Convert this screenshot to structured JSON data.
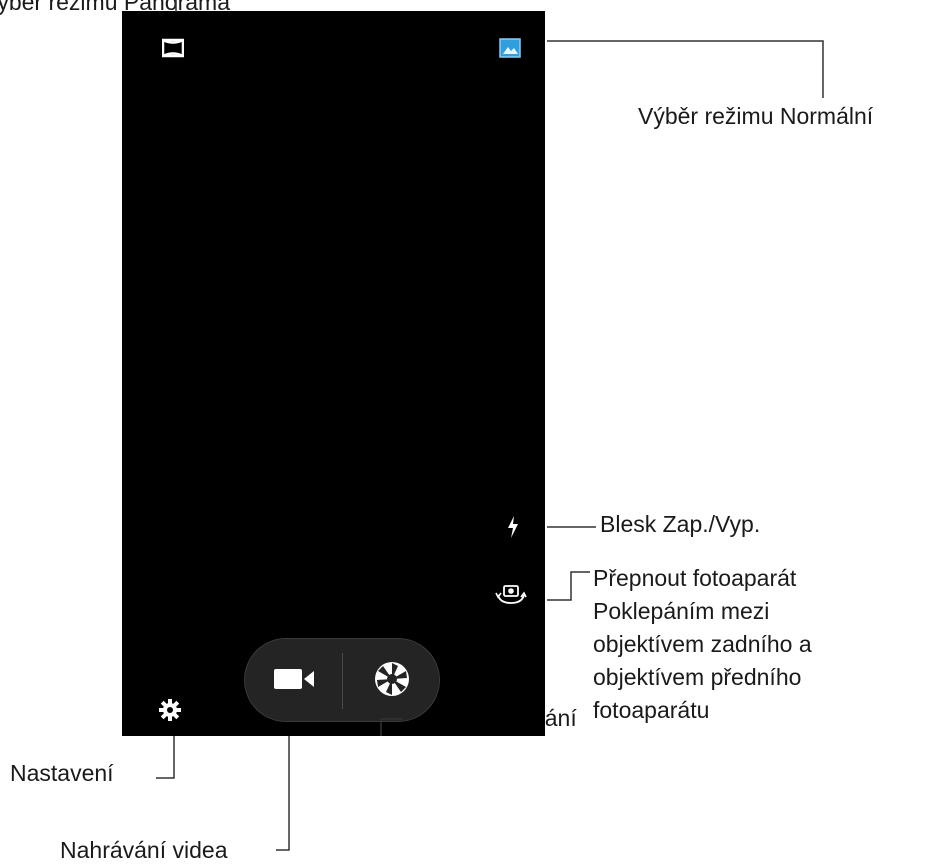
{
  "screen": {
    "icons": {
      "panorama": "panorama-icon",
      "normal": "image-icon",
      "flash": "flash-icon",
      "switch_camera": "switch-camera-icon",
      "settings": "gear-icon",
      "video": "video-camera-icon",
      "shutter": "shutter-icon"
    },
    "colors": {
      "background": "#000000",
      "accent": "#2f9fe0",
      "pill": "#242424"
    }
  },
  "labels": {
    "panorama": "Výběr režimu Panoráma",
    "normal": "Výběr režimu Normální",
    "flash": "Blesk Zap./Vyp.",
    "switch_camera": [
      "Přepnout fotoaparát",
      "Poklepáním mezi",
      "objektívem zadního a",
      "objektívem předního",
      "fotoaparátu"
    ],
    "settings": "Nastavení",
    "shutter": "Tlačítko snímání",
    "video": "Nahrávání videa"
  }
}
